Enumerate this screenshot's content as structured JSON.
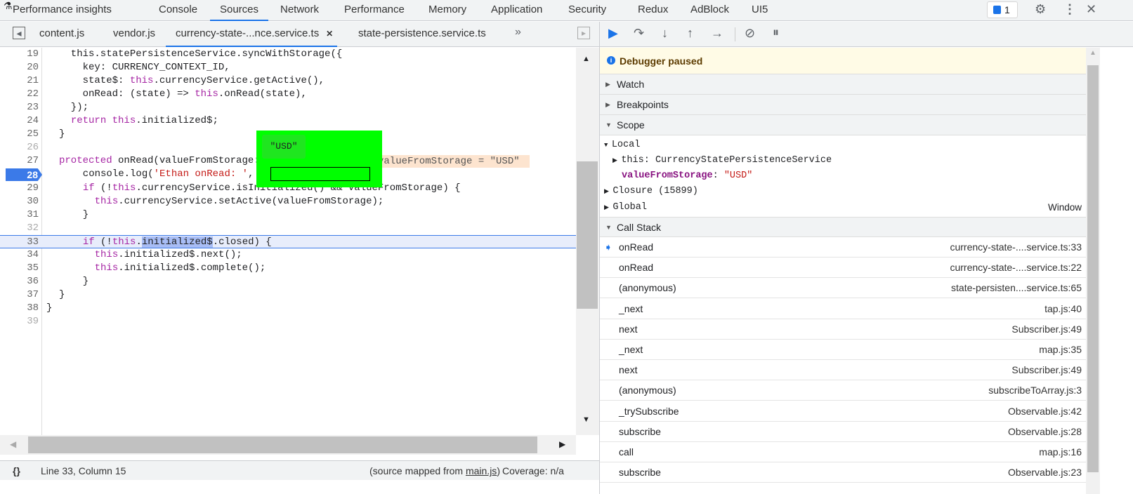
{
  "top_tabs": [
    "Performance insights",
    "Console",
    "Sources",
    "Network",
    "Performance",
    "Memory",
    "Application",
    "Security",
    "Redux",
    "AdBlock",
    "UI5"
  ],
  "active_top_tab": "Sources",
  "issues_count": "1",
  "file_tabs": [
    "content.js",
    "vendor.js",
    "currency-state-...nce.service.ts",
    "state-persistence.service.ts"
  ],
  "active_file_tab": "currency-state-...nce.service.ts",
  "code_lines": [
    {
      "n": "19",
      "t": [
        [
          "",
          "  this.statePersistenceService.syncWithStorage({"
        ]
      ]
    },
    {
      "n": "20",
      "t": [
        [
          "",
          "    key: CURRENCY_CONTEXT_ID,"
        ]
      ]
    },
    {
      "n": "21",
      "t": [
        [
          "",
          "    state$: "
        ],
        [
          "kw",
          "this"
        ],
        [
          "",
          ".currencyService.getActive(),"
        ]
      ]
    },
    {
      "n": "22",
      "t": [
        [
          "",
          "    onRead: (state) => "
        ],
        [
          "kw",
          "this"
        ],
        [
          "",
          ".onRead(state),"
        ]
      ]
    },
    {
      "n": "23",
      "t": [
        [
          "",
          "  });"
        ]
      ]
    },
    {
      "n": "24",
      "t": [
        [
          "",
          "  "
        ],
        [
          "kw",
          "return this"
        ],
        [
          "",
          ".initialized$;"
        ]
      ]
    },
    {
      "n": "25",
      "t": [
        [
          "",
          "}"
        ]
      ]
    },
    {
      "n": "26",
      "t": []
    },
    {
      "n": "27",
      "t": [
        [
          "kw",
          "protected"
        ],
        [
          "",
          " onRead(valueFromStorage: string): void {"
        ]
      ]
    },
    {
      "n": "28",
      "t": [
        [
          "",
          "  console.log("
        ],
        [
          "str",
          "'Ethan onRead: '"
        ],
        [
          "",
          ", valueFromStorage);"
        ]
      ]
    },
    {
      "n": "29",
      "t": [
        [
          "",
          "  "
        ],
        [
          "kw",
          "if"
        ],
        [
          "",
          " (!"
        ],
        [
          "kw",
          "this"
        ],
        [
          "",
          ".currencyService.isInitialized() && valueFromStorage) {"
        ]
      ]
    },
    {
      "n": "30",
      "t": [
        [
          "",
          "    "
        ],
        [
          "kw",
          "this"
        ],
        [
          "",
          ".currencyService.setActive(valueFromStorage);"
        ]
      ]
    },
    {
      "n": "31",
      "t": [
        [
          "",
          "  }"
        ]
      ]
    },
    {
      "n": "32",
      "t": []
    },
    {
      "n": "33",
      "t": [
        [
          "",
          "  "
        ],
        [
          "kw",
          "if"
        ],
        [
          "",
          " (!"
        ],
        [
          "kw",
          "this"
        ],
        [
          "",
          "."
        ],
        [
          "sel",
          "initialized$"
        ],
        [
          "",
          ".closed) {"
        ]
      ]
    },
    {
      "n": "34",
      "t": [
        [
          "",
          "    "
        ],
        [
          "kw",
          "this"
        ],
        [
          "",
          ".initialized$.next();"
        ]
      ]
    },
    {
      "n": "35",
      "t": [
        [
          "",
          "    "
        ],
        [
          "kw",
          "this"
        ],
        [
          "",
          ".initialized$.complete();"
        ]
      ]
    },
    {
      "n": "36",
      "t": [
        [
          "",
          "  }"
        ]
      ]
    },
    {
      "n": "37",
      "t": [
        [
          "",
          "}"
        ]
      ]
    },
    {
      "n": "38",
      "t": [
        [
          "",
          "}"
        ]
      ]
    },
    {
      "n": "39",
      "t": []
    }
  ],
  "breakpoint_line": "28",
  "inline_value": "valueFromStorage = \"USD\"",
  "hover_popover_value": "\"USD\"",
  "status": {
    "position": "Line 33, Column 15",
    "source_mapped_prefix": "(source mapped from ",
    "source_mapped_link": "main.js",
    "source_mapped_suffix": ")",
    "coverage": "Coverage: n/a"
  },
  "debugger": {
    "paused_message": "Debugger paused",
    "sections": {
      "watch": "Watch",
      "breakpoints": "Breakpoints",
      "scope": "Scope",
      "call_stack": "Call Stack"
    },
    "scope": {
      "local": "Local",
      "this_label": "this",
      "this_value": "CurrencyStatePersistenceService",
      "var_name": "valueFromStorage",
      "var_value": "\"USD\"",
      "closure": "Closure (15899)",
      "global": "Global",
      "global_value": "Window"
    },
    "call_stack": [
      [
        "onRead",
        "currency-state-....service.ts:33"
      ],
      [
        "onRead",
        "currency-state-....service.ts:22"
      ],
      [
        "(anonymous)",
        "state-persisten....service.ts:65"
      ],
      [
        "_next",
        "tap.js:40"
      ],
      [
        "next",
        "Subscriber.js:49"
      ],
      [
        "_next",
        "map.js:35"
      ],
      [
        "next",
        "Subscriber.js:49"
      ],
      [
        "(anonymous)",
        "subscribeToArray.js:3"
      ],
      [
        "_trySubscribe",
        "Observable.js:42"
      ],
      [
        "subscribe",
        "Observable.js:28"
      ],
      [
        "call",
        "map.js:16"
      ],
      [
        "subscribe",
        "Observable.js:23"
      ]
    ]
  },
  "colors": {
    "accent": "#1a73e8",
    "popover": "#00ff00",
    "paused_bg": "#fffbe6"
  }
}
